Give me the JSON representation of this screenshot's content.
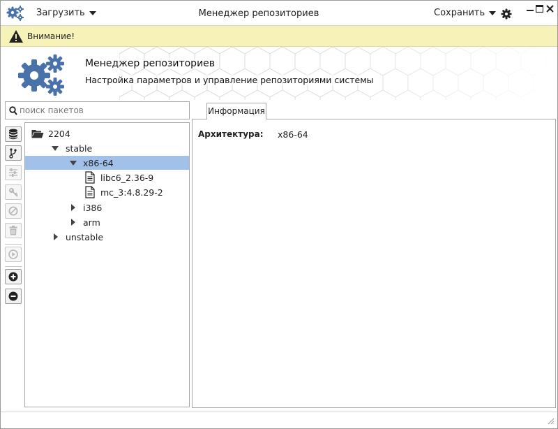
{
  "titlebar": {
    "load_label": "Загрузить",
    "title": "Менеджер репозиториев",
    "save_label": "Сохранить"
  },
  "warning": {
    "text": "Внимание!",
    "color": "#f7f2b8"
  },
  "header": {
    "title": "Менеджер репозиториев",
    "subtitle": "Настройка параметров и управление репозиториями системы",
    "icon_color": "#4a72aa"
  },
  "search": {
    "placeholder": "поиск пакетов",
    "value": ""
  },
  "toolbar": {
    "buttons": [
      {
        "icon": "database-icon",
        "enabled": true
      },
      {
        "icon": "branch-icon",
        "enabled": true
      },
      {
        "icon": "sliders-icon",
        "enabled": false
      },
      {
        "icon": "key-icon",
        "enabled": false
      },
      {
        "icon": "block-icon",
        "enabled": false
      },
      {
        "icon": "trash-icon",
        "enabled": false
      },
      {
        "icon": "play-icon",
        "enabled": false
      },
      {
        "icon": "plus-circle-icon",
        "enabled": true
      },
      {
        "icon": "minus-circle-icon",
        "enabled": true
      }
    ]
  },
  "tree": {
    "root": "2204",
    "stable": "stable",
    "x86": "x86-64",
    "pkg1": "libc6_2.36-9",
    "pkg2": "mc_3:4.8.29-2",
    "i386": "i386",
    "arm": "arm",
    "unstable": "unstable",
    "selection_color": "#a2c1ea"
  },
  "details": {
    "tab_label": "Информация",
    "arch_label": "Архитектура:",
    "arch_value": "x86-64"
  }
}
